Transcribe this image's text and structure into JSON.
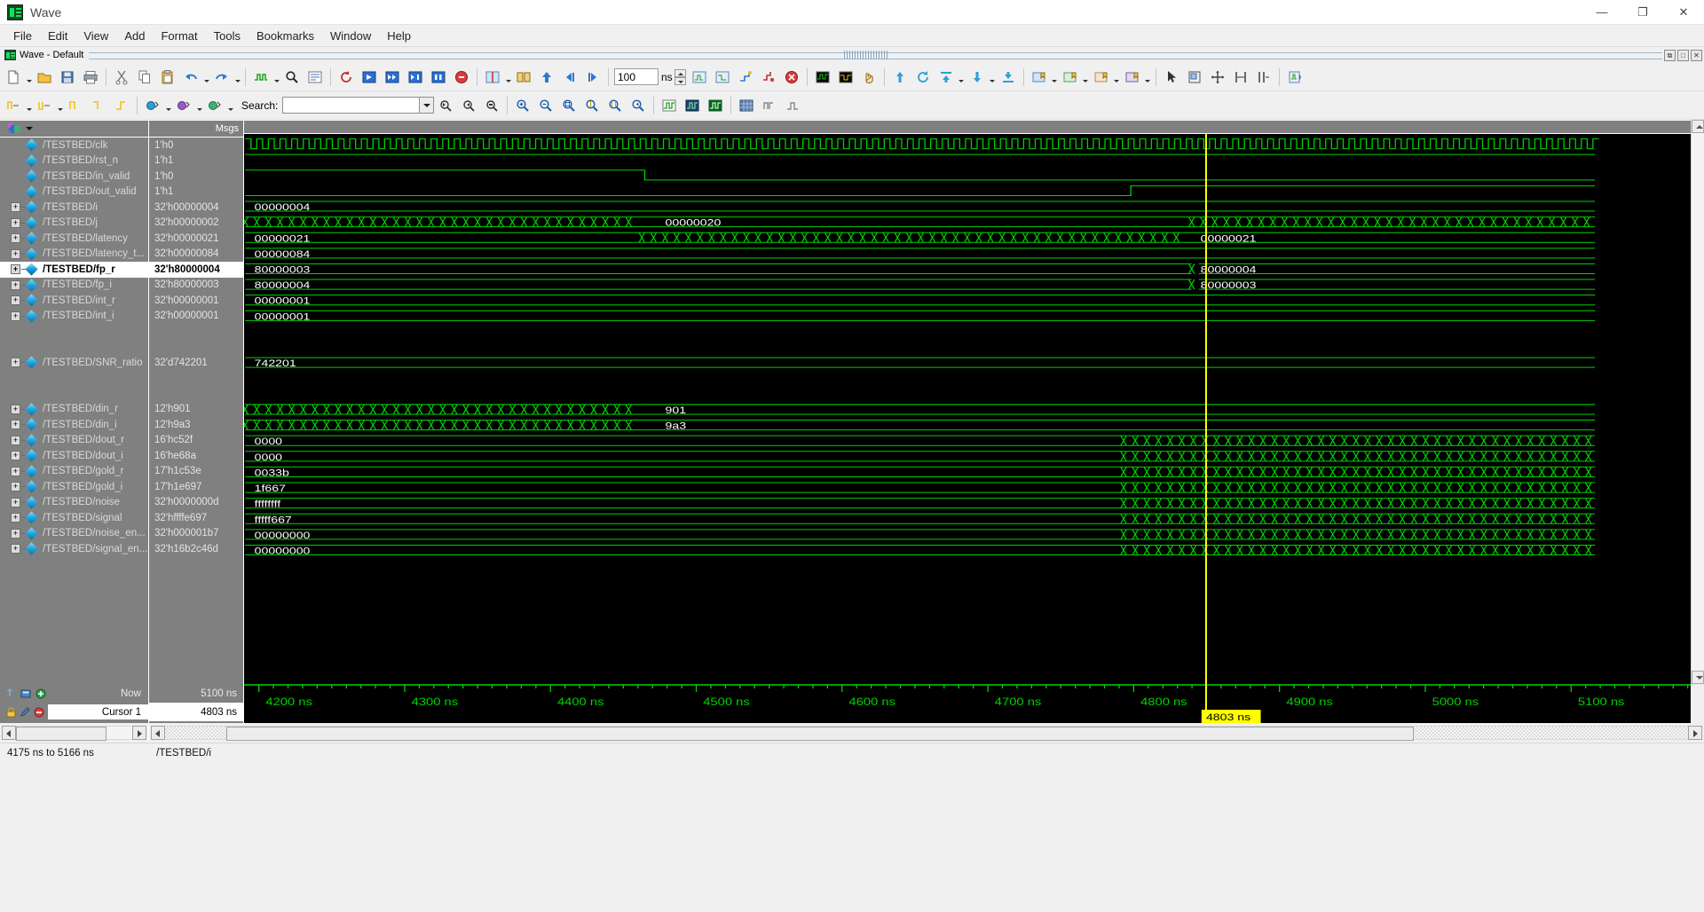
{
  "window": {
    "title": "Wave",
    "app_icon": "modelsim-wave-icon",
    "buttons": {
      "minimize": "—",
      "maximize": "❐",
      "close": "✕"
    }
  },
  "menubar": {
    "items": [
      "File",
      "Edit",
      "View",
      "Add",
      "Format",
      "Tools",
      "Bookmarks",
      "Window",
      "Help"
    ]
  },
  "docbar": {
    "label": "Wave - Default",
    "buttons": [
      "undock-button",
      "maximize-pane-button",
      "close-pane-button"
    ],
    "button_glyphs": [
      "⧉",
      "□",
      "✕"
    ]
  },
  "toolbar_main": {
    "step_value": "100",
    "step_unit": "ns",
    "groups": [
      [
        "new-file-icon",
        "open-file-icon",
        "save-icon",
        "print-icon"
      ],
      [
        "cut-icon",
        "copy-icon",
        "paste-icon",
        "undo-icon",
        "redo-icon"
      ],
      [
        "add-wave-icon",
        "find-icon",
        "find-options-icon"
      ],
      [
        "restart-icon",
        "run-icon",
        "continue-run-icon",
        "run-all-icon",
        "break-icon",
        "stop-icon"
      ],
      [
        "insert-cursor-icon",
        "grouping-icon",
        "move-up-icon",
        "prev-transition-icon",
        "next-transition-icon",
        "find-next-icon"
      ],
      [
        "step-value-field",
        "run-length-icon",
        "run-length-2-icon",
        "step-icon",
        "step-over-icon",
        "stop-run-icon"
      ],
      [
        "wave-compare-icon",
        "wave-compare-2-icon",
        "pan-hand-icon"
      ],
      [
        "signal-up-icon",
        "signal-reload-icon",
        "signal-top-icon",
        "signal-down-icon",
        "signal-bottom-icon"
      ],
      [
        "bookmark-1-icon",
        "bookmark-2-icon",
        "bookmark-3-icon",
        "bookmark-4-icon"
      ],
      [
        "select-mode-icon",
        "zoom-mode-icon",
        "pan-mode-icon",
        "measure-icon",
        "edit-mode-icon",
        "wave-edit-icon"
      ]
    ]
  },
  "toolbar_wave": {
    "search_label": "Search:",
    "search_value": "",
    "search_placeholder": "",
    "groups": [
      [
        "wave-insert-icon",
        "wave-insert-2-icon",
        "wave-insert-3-icon",
        "wave-insert-4-icon",
        "wave-insert-5-icon"
      ],
      [
        "radix-icon",
        "format-icon",
        "properties-icon"
      ],
      [
        "search-prev-icon",
        "search-next-icon",
        "search-all-icon"
      ],
      [
        "zoom-in-icon",
        "zoom-out-icon",
        "zoom-full-icon",
        "zoom-cursor-icon",
        "zoom-range-icon",
        "zoom-last-icon"
      ],
      [
        "wave-view-1-icon",
        "wave-view-2-icon",
        "wave-view-3-icon"
      ],
      [
        "wave-grid-icon",
        "wave-analog-1-icon",
        "wave-analog-2-icon"
      ]
    ]
  },
  "signal_pane": {
    "name_header": "",
    "value_header": "Msgs",
    "object_icon": "objects-icon",
    "rows": [
      {
        "name": "/TESTBED/clk",
        "value": "1'h0",
        "expandable": false,
        "selected": false,
        "spacer": false
      },
      {
        "name": "/TESTBED/rst_n",
        "value": "1'h1",
        "expandable": false,
        "selected": false,
        "spacer": false
      },
      {
        "name": "/TESTBED/in_valid",
        "value": "1'h0",
        "expandable": false,
        "selected": false,
        "spacer": false
      },
      {
        "name": "/TESTBED/out_valid",
        "value": "1'h1",
        "expandable": false,
        "selected": false,
        "spacer": false
      },
      {
        "name": "/TESTBED/i",
        "value": "32'h00000004",
        "expandable": true,
        "selected": false,
        "spacer": false
      },
      {
        "name": "/TESTBED/j",
        "value": "32'h00000002",
        "expandable": true,
        "selected": false,
        "spacer": false
      },
      {
        "name": "/TESTBED/latency",
        "value": "32'h00000021",
        "expandable": true,
        "selected": false,
        "spacer": false
      },
      {
        "name": "/TESTBED/latency_t...",
        "value": "32'h00000084",
        "expandable": true,
        "selected": false,
        "spacer": false
      },
      {
        "name": "/TESTBED/fp_r",
        "value": "32'h80000004",
        "expandable": true,
        "selected": true,
        "spacer": false
      },
      {
        "name": "/TESTBED/fp_i",
        "value": "32'h80000003",
        "expandable": true,
        "selected": false,
        "spacer": false
      },
      {
        "name": "/TESTBED/int_r",
        "value": "32'h00000001",
        "expandable": true,
        "selected": false,
        "spacer": false
      },
      {
        "name": "/TESTBED/int_i",
        "value": "32'h00000001",
        "expandable": true,
        "selected": false,
        "spacer": false
      },
      {
        "name": "",
        "value": "",
        "expandable": false,
        "selected": false,
        "spacer": true
      },
      {
        "name": "",
        "value": "",
        "expandable": false,
        "selected": false,
        "spacer": true
      },
      {
        "name": "/TESTBED/SNR_ratio",
        "value": "32'd742201",
        "expandable": true,
        "selected": false,
        "spacer": false
      },
      {
        "name": "",
        "value": "",
        "expandable": false,
        "selected": false,
        "spacer": true
      },
      {
        "name": "",
        "value": "",
        "expandable": false,
        "selected": false,
        "spacer": true
      },
      {
        "name": "/TESTBED/din_r",
        "value": "12'h901",
        "expandable": true,
        "selected": false,
        "spacer": false
      },
      {
        "name": "/TESTBED/din_i",
        "value": "12'h9a3",
        "expandable": true,
        "selected": false,
        "spacer": false
      },
      {
        "name": "/TESTBED/dout_r",
        "value": "16'hc52f",
        "expandable": true,
        "selected": false,
        "spacer": false
      },
      {
        "name": "/TESTBED/dout_i",
        "value": "16'he68a",
        "expandable": true,
        "selected": false,
        "spacer": false
      },
      {
        "name": "/TESTBED/gold_r",
        "value": "17'h1c53e",
        "expandable": true,
        "selected": false,
        "spacer": false
      },
      {
        "name": "/TESTBED/gold_i",
        "value": "17'h1e697",
        "expandable": true,
        "selected": false,
        "spacer": false
      },
      {
        "name": "/TESTBED/noise",
        "value": "32'h0000000d",
        "expandable": true,
        "selected": false,
        "spacer": false
      },
      {
        "name": "/TESTBED/signal",
        "value": "32'hffffe697",
        "expandable": true,
        "selected": false,
        "spacer": false
      },
      {
        "name": "/TESTBED/noise_en...",
        "value": "32'h000001b7",
        "expandable": true,
        "selected": false,
        "spacer": false
      },
      {
        "name": "/TESTBED/signal_en...",
        "value": "32'h16b2c46d",
        "expandable": true,
        "selected": false,
        "spacer": false
      }
    ]
  },
  "waveform": {
    "bus_labels": [
      {
        "row": 4,
        "text": "00000004",
        "x_pct": 0.4
      },
      {
        "row": 5,
        "text": "00000020",
        "x_pct": 28.8
      },
      {
        "row": 6,
        "text": "00000021",
        "x_pct": 0.4
      },
      {
        "row": 6,
        "text": "00000021",
        "x_pct": 65.8
      },
      {
        "row": 7,
        "text": "00000084",
        "x_pct": 0.4
      },
      {
        "row": 8,
        "text": "80000003",
        "x_pct": 0.4
      },
      {
        "row": 8,
        "text": "80000004",
        "x_pct": 65.8
      },
      {
        "row": 9,
        "text": "80000004",
        "x_pct": 0.4
      },
      {
        "row": 9,
        "text": "80000003",
        "x_pct": 65.8
      },
      {
        "row": 10,
        "text": "00000001",
        "x_pct": 0.4
      },
      {
        "row": 11,
        "text": "00000001",
        "x_pct": 0.4
      },
      {
        "row": 14,
        "text": "742201",
        "x_pct": 0.4
      },
      {
        "row": 17,
        "text": "901",
        "x_pct": 28.8
      },
      {
        "row": 18,
        "text": "9a3",
        "x_pct": 28.8
      },
      {
        "row": 19,
        "text": "0000",
        "x_pct": 0.4
      },
      {
        "row": 20,
        "text": "0000",
        "x_pct": 0.4
      },
      {
        "row": 21,
        "text": "0033b",
        "x_pct": 0.4
      },
      {
        "row": 22,
        "text": "1f667",
        "x_pct": 0.4
      },
      {
        "row": 23,
        "text": "ffffffff",
        "x_pct": 0.4
      },
      {
        "row": 24,
        "text": "fffff667",
        "x_pct": 0.4
      },
      {
        "row": 25,
        "text": "00000000",
        "x_pct": 0.4
      },
      {
        "row": 26,
        "text": "00000000",
        "x_pct": 0.4
      }
    ],
    "colors": {
      "signal_green": "#00d200",
      "background": "#000000",
      "cursor_yellow": "#ffff00",
      "grid": "#262626"
    }
  },
  "timeline": {
    "ticks": [
      "4200 ns",
      "4300 ns",
      "4400 ns",
      "4500 ns",
      "4600 ns",
      "4700 ns",
      "4800 ns",
      "4900 ns",
      "5000 ns",
      "5100 ns"
    ],
    "cursor_flag": "4803 ns",
    "cursor_x_pct": 66.5
  },
  "footer": {
    "now_label": "Now",
    "now_value": "5100 ns",
    "cursor_label": "Cursor 1",
    "cursor_value": "4803 ns",
    "now_icons": [
      "find-prev-icon",
      "find-next-icon",
      "add-cursor-icon"
    ],
    "cursor_icons": [
      "lock-cursor-icon",
      "edit-cursor-icon",
      "delete-cursor-icon"
    ]
  },
  "statusbar": {
    "range": "4175 ns to 5166 ns",
    "scope": "/TESTBED/i"
  }
}
